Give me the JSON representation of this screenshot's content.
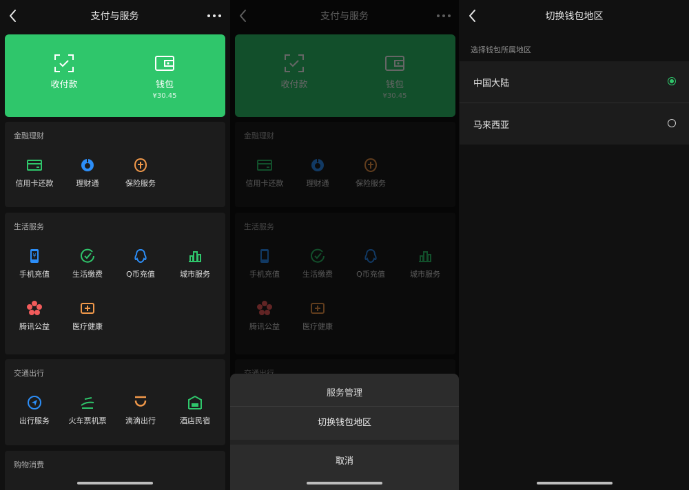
{
  "colors": {
    "accent": "#2fc66b",
    "background": "#111111",
    "card": "#1c1c1c",
    "sheet": "#2c2c2c"
  },
  "screen1": {
    "title": "支付与服务",
    "hero": {
      "receive": {
        "label": "收付款",
        "icon": "qr-scan-icon"
      },
      "wallet": {
        "label": "钱包",
        "balance": "¥30.45",
        "icon": "wallet-icon"
      }
    },
    "sections": [
      {
        "title": "金融理财",
        "items": [
          {
            "label": "信用卡还款",
            "icon": "credit-card-icon",
            "color": "#2fc66b"
          },
          {
            "label": "理财通",
            "icon": "wealth-icon",
            "color": "#2c8ef8"
          },
          {
            "label": "保险服务",
            "icon": "insurance-icon",
            "color": "#f2994a"
          }
        ]
      },
      {
        "title": "生活服务",
        "items": [
          {
            "label": "手机充值",
            "icon": "phone-icon",
            "color": "#2c8ef8"
          },
          {
            "label": "生活缴费",
            "icon": "checkmark-icon",
            "color": "#2fc66b"
          },
          {
            "label": "Q币充值",
            "icon": "qq-icon",
            "color": "#2c8ef8"
          },
          {
            "label": "城市服务",
            "icon": "city-icon",
            "color": "#2fc66b"
          },
          {
            "label": "腾讯公益",
            "icon": "charity-icon",
            "color": "#f25b5b"
          },
          {
            "label": "医疗健康",
            "icon": "medical-icon",
            "color": "#f2994a"
          }
        ]
      },
      {
        "title": "交通出行",
        "items": [
          {
            "label": "出行服务",
            "icon": "navigation-icon",
            "color": "#2c8ef8"
          },
          {
            "label": "火车票机票",
            "icon": "train-icon",
            "color": "#2fc66b"
          },
          {
            "label": "滴滴出行",
            "icon": "didi-icon",
            "color": "#f2994a"
          },
          {
            "label": "酒店民宿",
            "icon": "hotel-icon",
            "color": "#2fc66b"
          }
        ]
      },
      {
        "title": "购物消费",
        "items": []
      }
    ]
  },
  "screen2": {
    "sheet": {
      "title": "服务管理",
      "option": "切换钱包地区",
      "cancel": "取消"
    }
  },
  "screen3": {
    "title": "切换钱包地区",
    "caption": "选择钱包所属地区",
    "regions": [
      {
        "label": "中国大陆",
        "selected": true
      },
      {
        "label": "马来西亚",
        "selected": false
      }
    ]
  }
}
